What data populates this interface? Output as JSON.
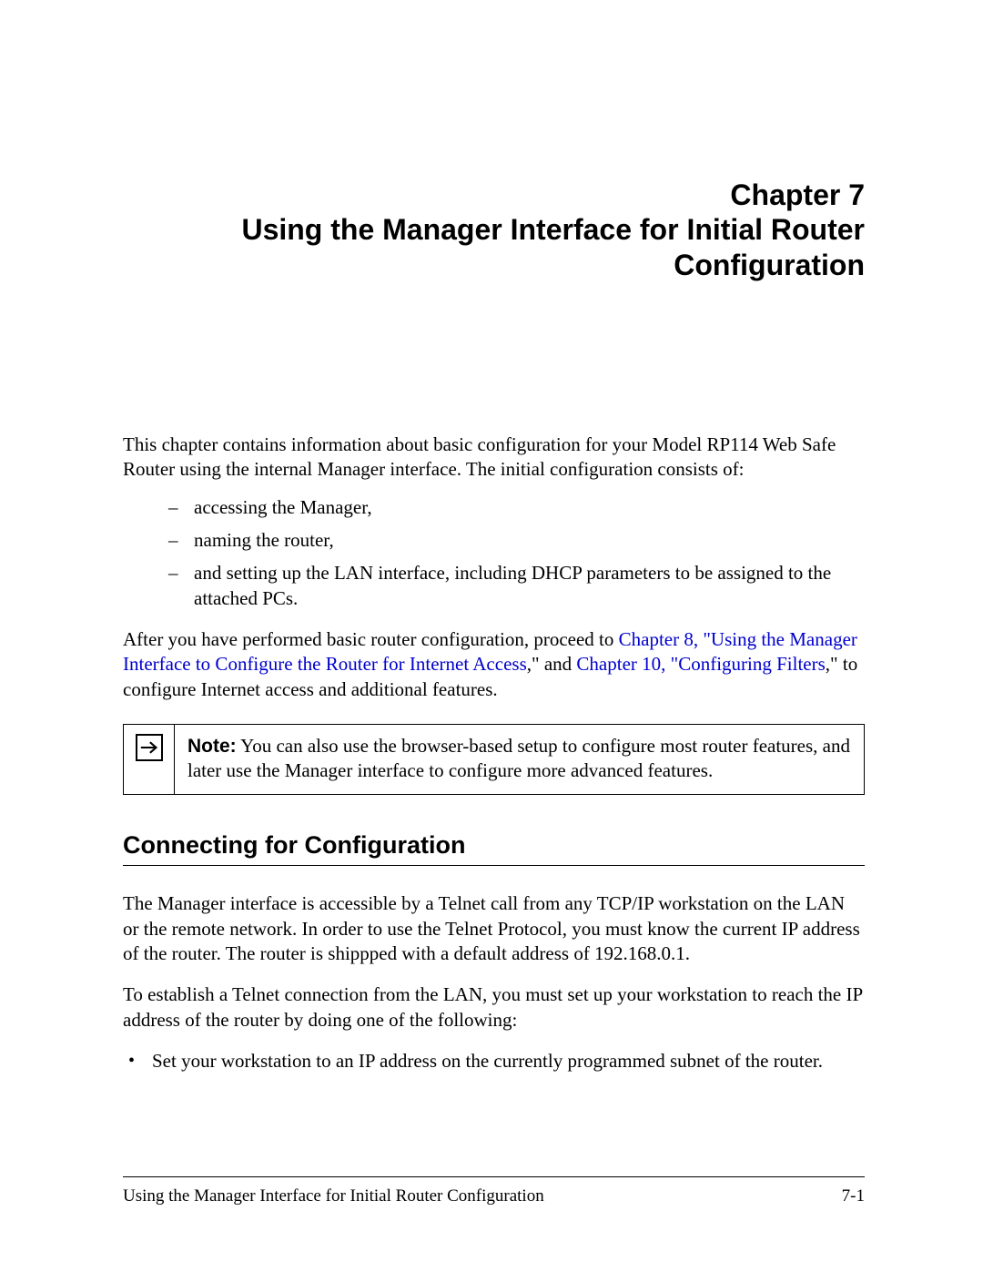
{
  "chapter": {
    "line1": "Chapter 7",
    "line2": "Using the Manager Interface for Initial Router",
    "line3": "Configuration"
  },
  "intro": "This chapter contains information about basic configuration for your Model RP114 Web Safe Router using the internal Manager interface. The initial configuration consists of:",
  "bullets_dash": [
    "accessing the Manager,",
    "naming the router,",
    "and setting up the LAN interface, including DHCP parameters to be assigned to the attached PCs."
  ],
  "after": {
    "pre": "After you have performed basic router configuration, proceed to ",
    "link1": "Chapter 8, \"Using the Manager Interface to Configure the Router for Internet Access",
    "mid1": ",\" and ",
    "link2": "Chapter 10, \"Configuring Filters",
    "tail": ",\" to configure Internet access and additional features."
  },
  "note": {
    "label": "Note:",
    "text": " You can also use the browser-based setup to configure most router features, and later use the Manager interface to configure more advanced features."
  },
  "section_heading": "Connecting for Configuration",
  "para1": "The Manager interface is accessible by a Telnet call from any TCP/IP workstation on the LAN or the remote network. In order to use the Telnet Protocol, you must know the current IP address of the router. The router is shippped with a default address of 192.168.0.1.",
  "para2": "To establish a Telnet connection from the LAN, you must set up your workstation to reach the IP address of the router by doing one of the following:",
  "bullets_dot": [
    "Set your workstation to an IP address on the currently programmed subnet of the router."
  ],
  "footer": {
    "left": "Using the Manager Interface for Initial Router Configuration",
    "right": "7-1"
  }
}
